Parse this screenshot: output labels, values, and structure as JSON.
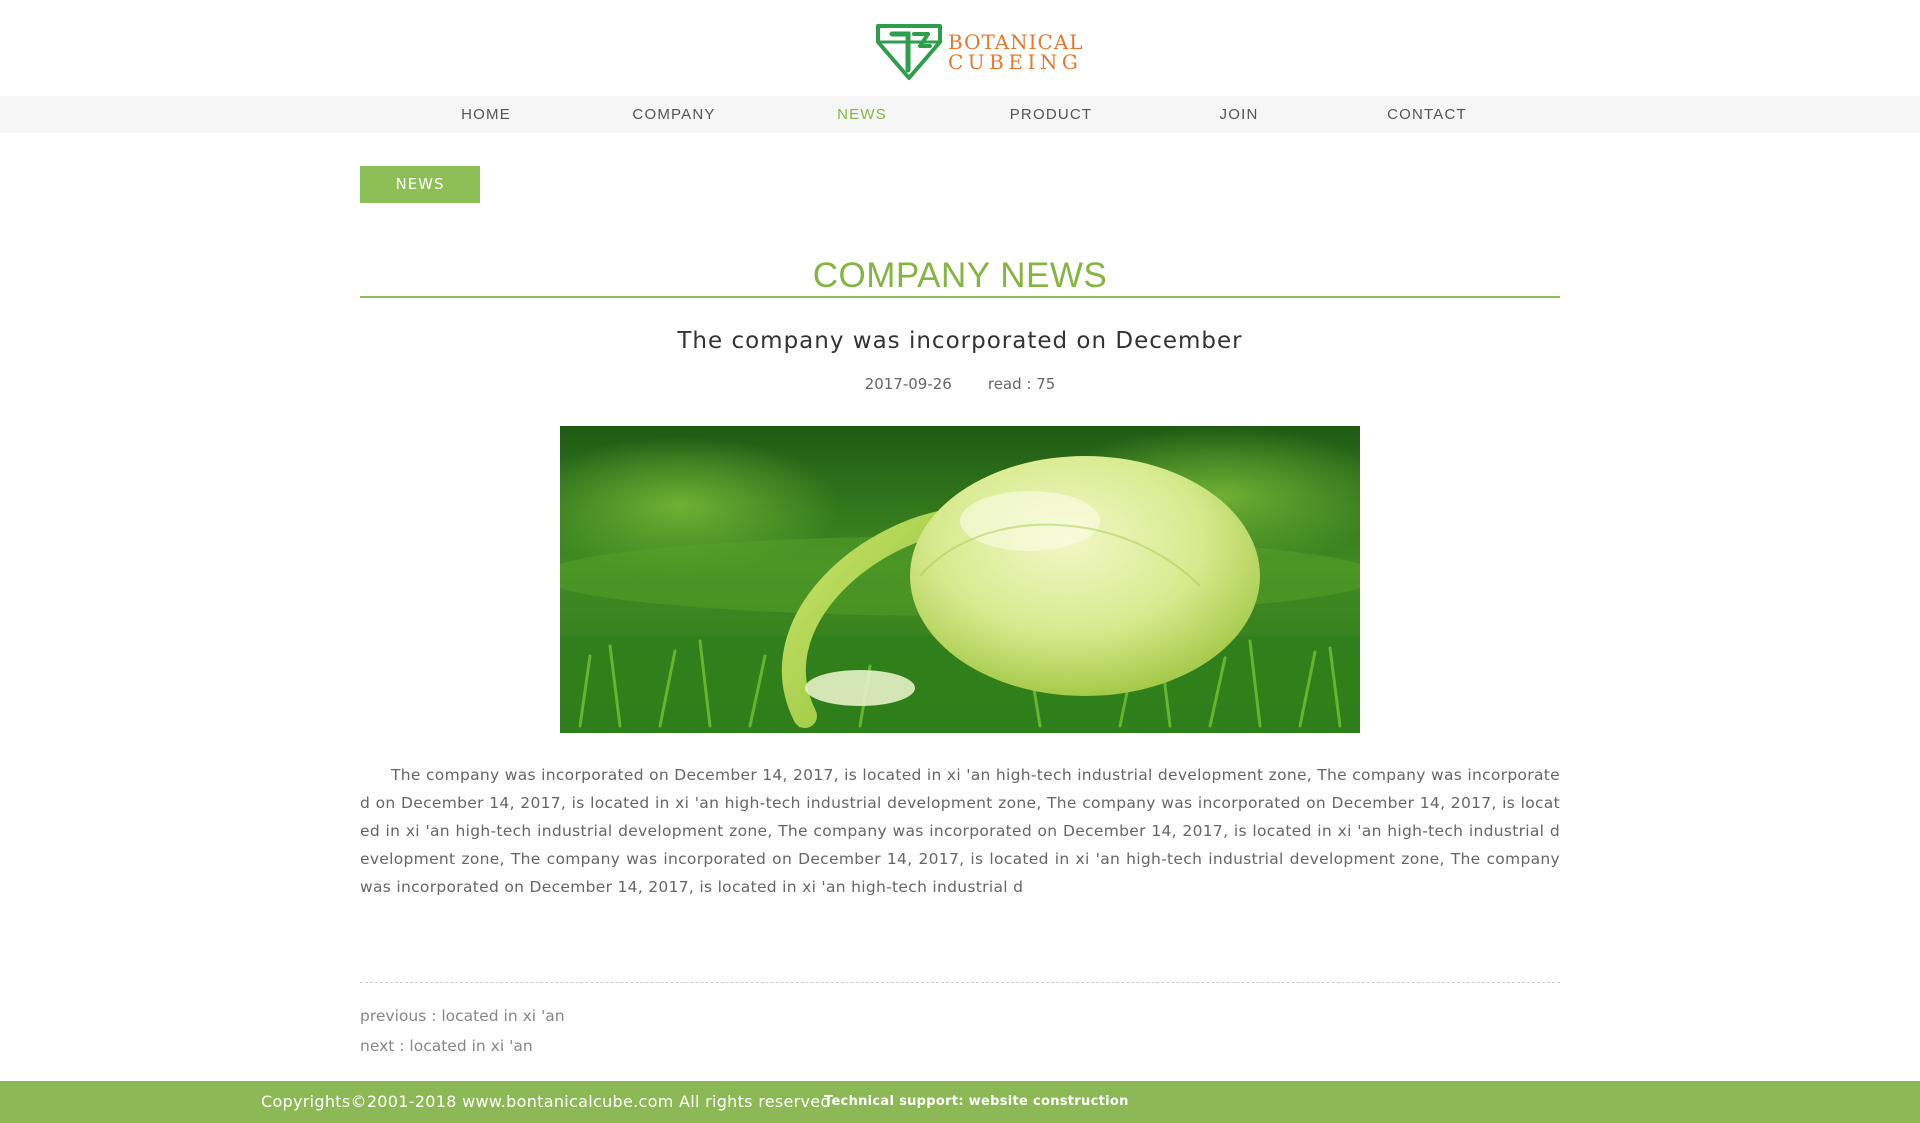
{
  "brand": {
    "line1": "BOTANICAL",
    "line2": "CUBEING",
    "accent_color": "#e8772e",
    "logo_color": "#2e9e4c"
  },
  "nav": {
    "items": [
      {
        "label": "HOME",
        "active": false
      },
      {
        "label": "COMPANY",
        "active": false
      },
      {
        "label": "NEWS",
        "active": true
      },
      {
        "label": "PRODUCT",
        "active": false
      },
      {
        "label": "JOIN",
        "active": false
      },
      {
        "label": "CONTACT",
        "active": false
      }
    ]
  },
  "sidebar": {
    "button_label": "NEWS"
  },
  "section": {
    "title": "COMPANY NEWS"
  },
  "article": {
    "title": "The company was incorporated on December",
    "date": "2017-09-26",
    "read_label": "read : 75",
    "image_icon": "seedling-photo",
    "body": "The company was incorporated on December 14, 2017, is located in xi 'an high-tech industrial development zone, The company was incorporated on December 14, 2017, is located in xi 'an high-tech industrial development zone, The company was incorporated on December 14, 2017, is located in xi 'an high-tech industrial development zone, The company was incorporated on December 14, 2017, is located in xi 'an high-tech industrial development zone,  The company was incorporated on December 14, 2017, is located in xi 'an high-tech industrial development zone, The company was incorporated on December 14, 2017, is located in xi 'an high-tech industrial d"
  },
  "pagination": {
    "previous": "previous :  located in xi 'an",
    "next": "next :  located in xi 'an"
  },
  "footer": {
    "copyright": "Copyrights©2001-2018 www.bontanicalcube.com All rights reserved",
    "tech_support": "Technical support: website construction"
  },
  "colors": {
    "green_accent": "#86b543",
    "footer_bg": "#8cb855",
    "nav_bg": "#f7f6f6"
  }
}
